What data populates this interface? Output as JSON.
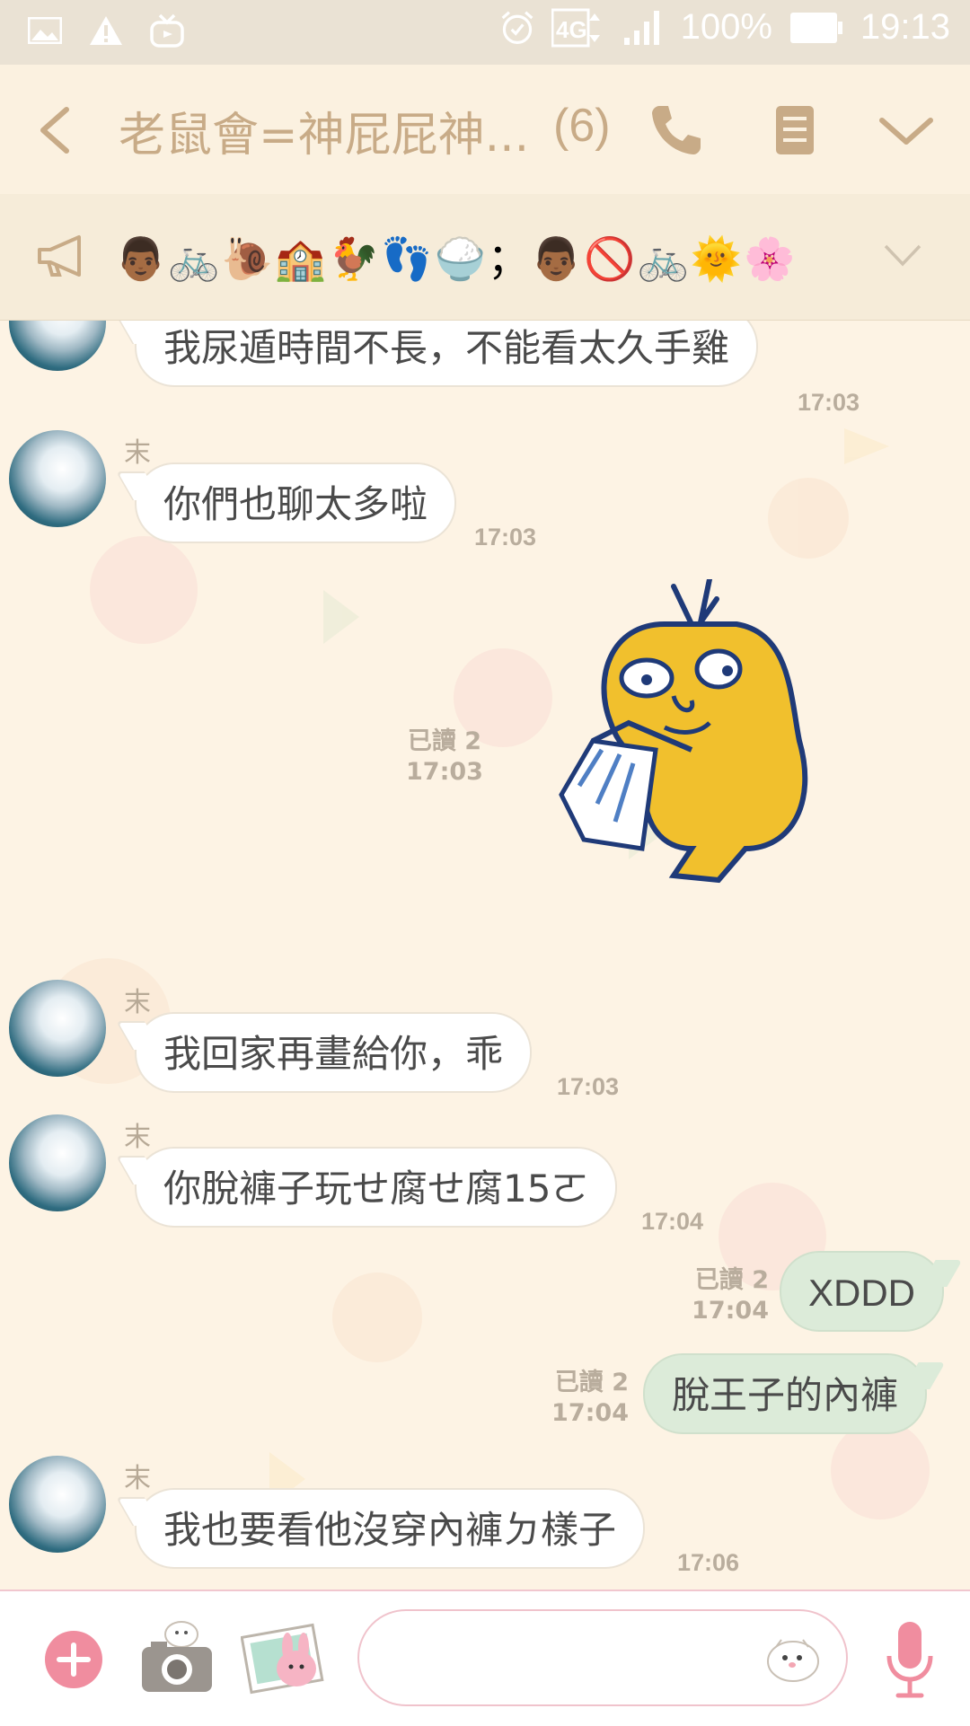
{
  "status_bar": {
    "network": "4G",
    "battery": "100%",
    "time": "19:13",
    "icons": [
      "gallery-icon",
      "warning-icon",
      "tv-icon",
      "alarm-icon",
      "network-4g-icon",
      "signal-icon",
      "battery-icon"
    ]
  },
  "header": {
    "title": "老鼠會=神屁屁神...",
    "member_count": "(6)",
    "icons": [
      "back-icon",
      "phone-icon",
      "notes-icon",
      "chevron-down-icon"
    ]
  },
  "notice": {
    "emojis": "👨🏾🚲🐌🏫🐓👣🍚；👨🏾🚫🚲🌞🌸"
  },
  "colors": {
    "background": "#fdf3e4",
    "header": "#fbf1e0",
    "outgoing_bubble": "#dcebd9",
    "accent_pink": "#f08d9f",
    "title_text": "#c8ab87"
  },
  "messages": [
    {
      "type": "in",
      "sender": "",
      "text": "我尿遁時間不長，不能看太久手雞",
      "time": "17:03"
    },
    {
      "type": "in",
      "sender": "末",
      "text": "你們也聊太多啦",
      "time": "17:03"
    },
    {
      "type": "sticker_out",
      "read": "已讀 2",
      "time": "17:03"
    },
    {
      "type": "in",
      "sender": "末",
      "text": "我回家再畫給你，乖",
      "time": "17:03"
    },
    {
      "type": "in",
      "sender": "末",
      "text": "你脫褲子玩せ腐せ腐15ㄛ",
      "time": "17:04"
    },
    {
      "type": "out",
      "text": "XDDD",
      "read": "已讀 2",
      "time": "17:04"
    },
    {
      "type": "out",
      "text": "脫王子的內褲",
      "read": "已讀 2",
      "time": "17:04"
    },
    {
      "type": "in",
      "sender": "末",
      "text": "我也要看他沒穿內褲ㄉ樣子",
      "time": "17:06"
    }
  ],
  "input": {
    "placeholder": ""
  }
}
